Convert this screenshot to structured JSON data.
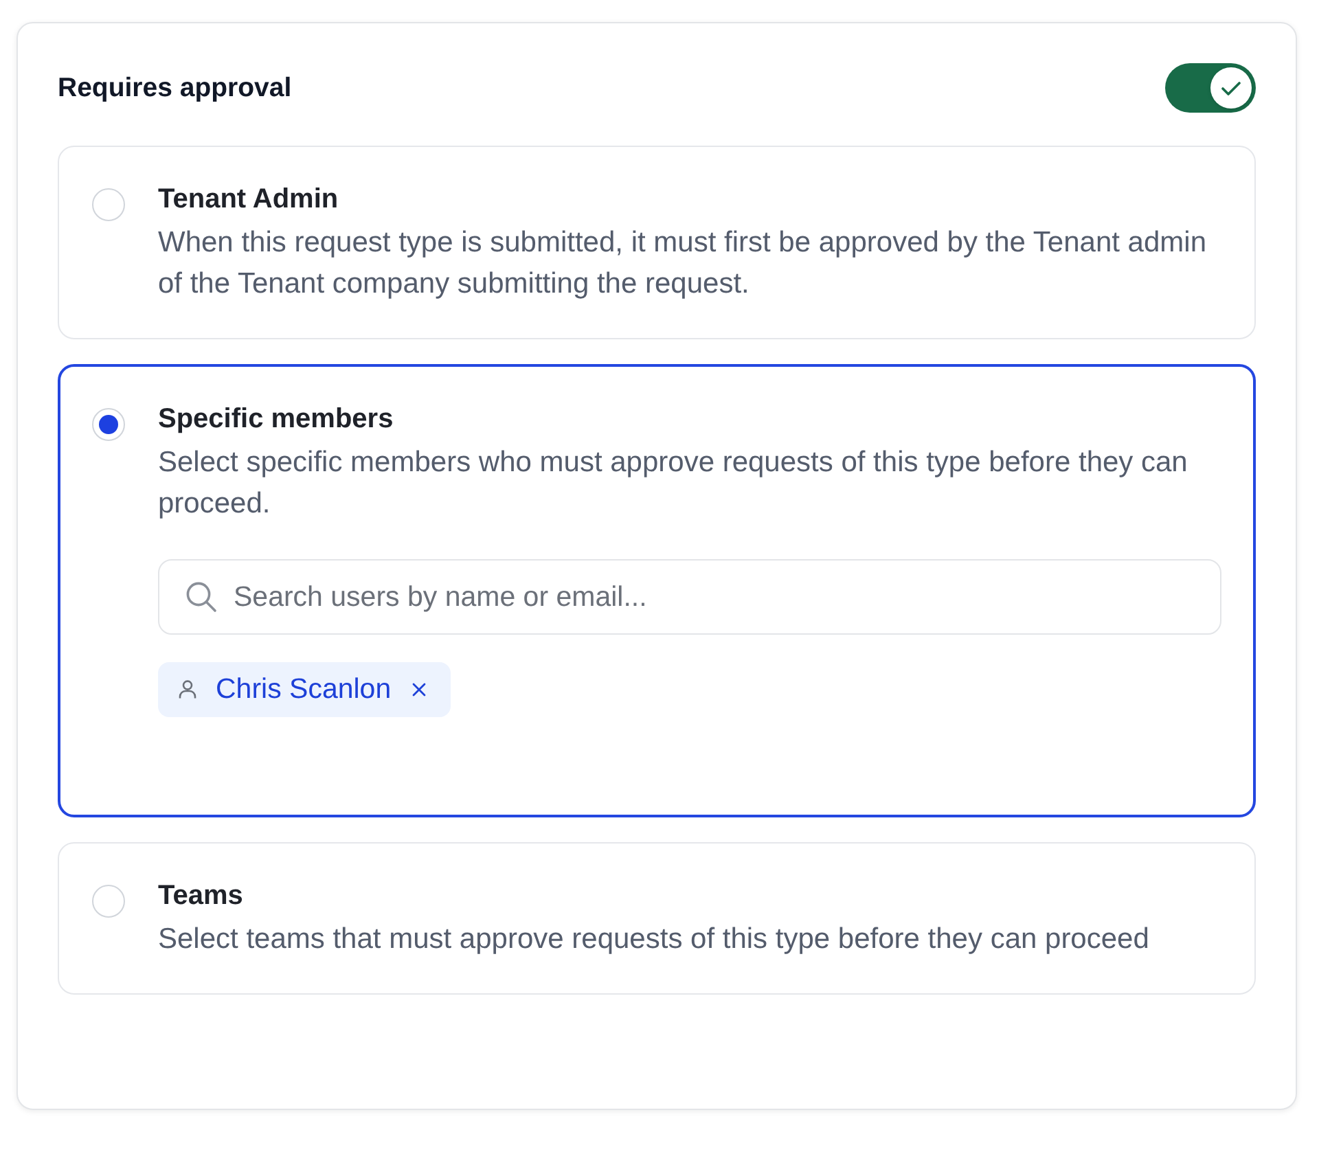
{
  "header": {
    "title": "Requires approval",
    "toggle": {
      "on": true
    }
  },
  "options": [
    {
      "title": "Tenant Admin",
      "description": "When this request type is submitted, it must first be approved by the Tenant admin of the Tenant company submitting the request.",
      "selected": false
    },
    {
      "title": "Specific members",
      "description": "Select specific members who must approve requests of this type before they can proceed.",
      "selected": true,
      "search": {
        "placeholder": "Search users by name or email..."
      },
      "members": [
        {
          "name": "Chris Scanlon"
        }
      ]
    },
    {
      "title": "Teams",
      "description": "Select teams that must approve requests of this type before they can proceed",
      "selected": false
    }
  ]
}
